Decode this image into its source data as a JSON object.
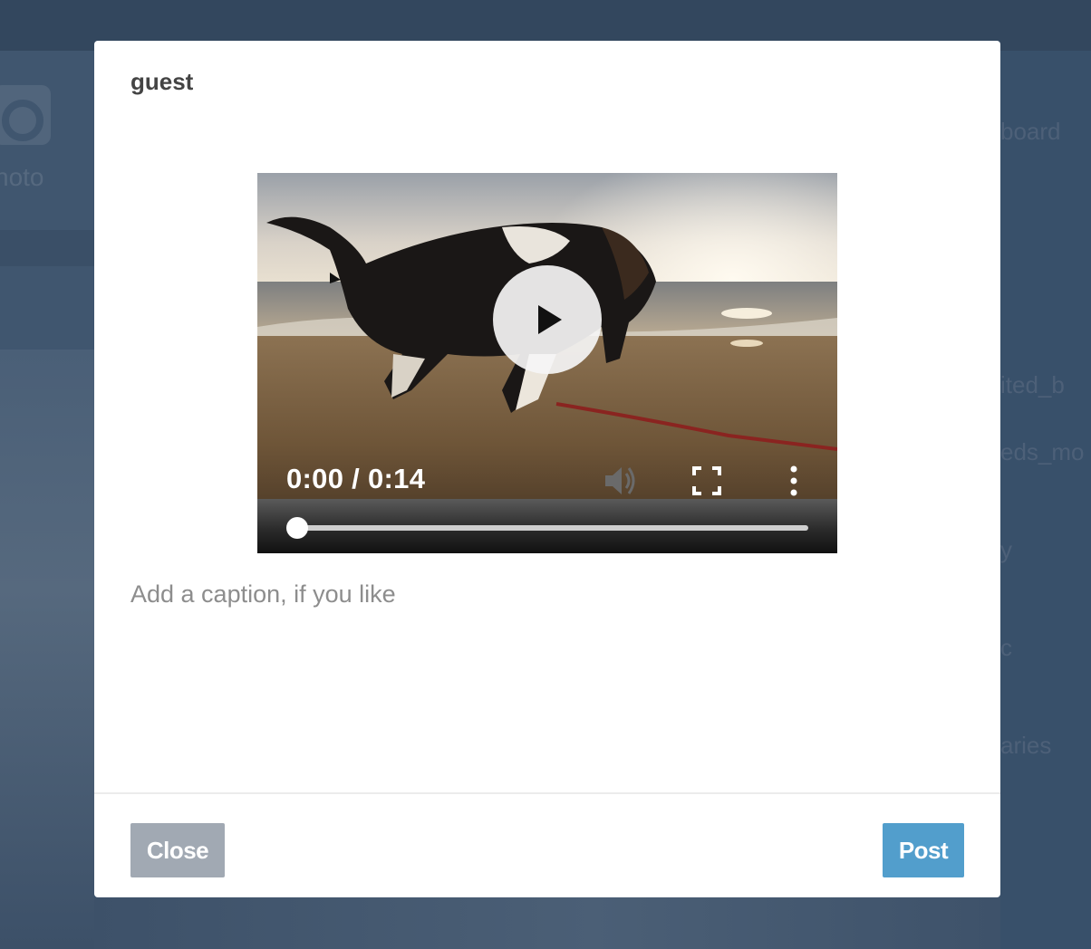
{
  "background": {
    "camera_label": "hoto",
    "right_items": [
      "board",
      "ited_b",
      "eds_mo",
      "y",
      "c",
      "aries"
    ]
  },
  "modal": {
    "blog_name": "guest",
    "video": {
      "time": "0:00 / 0:14",
      "progress": 0.0,
      "play_icon": "play-icon",
      "volume_icon": "volume-icon",
      "fullscreen_icon": "fullscreen-icon",
      "more_icon": "more-vertical-icon"
    },
    "caption_placeholder": "Add a caption, if you like",
    "close_label": "Close",
    "post_label": "Post"
  },
  "colors": {
    "post_button": "#529ecc",
    "close_button": "#a1a9b3",
    "overlay": "#364a62"
  }
}
